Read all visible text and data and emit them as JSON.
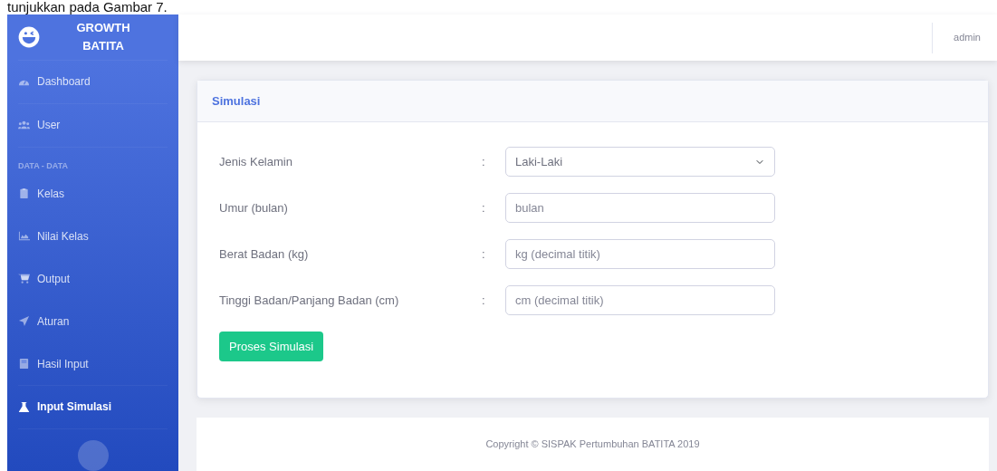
{
  "caption": "tunjukkan pada Gambar 7.",
  "sidebar": {
    "brand": "GROWTH BATITA",
    "sections": [
      {
        "items": [
          {
            "label": "Dashboard",
            "selected": false
          }
        ]
      },
      {
        "items": [
          {
            "label": "User",
            "selected": false
          }
        ]
      },
      {
        "heading": "DATA - DATA",
        "items": [
          {
            "label": "Kelas",
            "selected": false
          },
          {
            "label": "Nilai Kelas",
            "selected": false
          },
          {
            "label": "Output",
            "selected": false
          },
          {
            "label": "Aturan",
            "selected": false
          },
          {
            "label": "Hasil Input",
            "selected": false
          }
        ]
      },
      {
        "items": [
          {
            "label": "Input Simulasi",
            "selected": true
          }
        ]
      }
    ]
  },
  "topbar": {
    "user": "admin"
  },
  "card": {
    "title": "Simulasi",
    "fields": [
      {
        "kind": "select",
        "label": "Jenis Kelamin",
        "colon": ":",
        "value": "Laki-Laki"
      },
      {
        "kind": "input",
        "label": "Umur (bulan)",
        "colon": ":",
        "placeholder": "bulan"
      },
      {
        "kind": "input",
        "label": "Berat Badan (kg)",
        "colon": ":",
        "placeholder": "kg (decimal titik)"
      },
      {
        "kind": "input",
        "label": "Tinggi Badan/Panjang Badan (cm)",
        "colon": ":",
        "placeholder": "cm (decimal titik)"
      }
    ],
    "button": "Proses Simulasi"
  },
  "footer": "Copyright © SISPAK Pertumbuhan BATITA 2019"
}
